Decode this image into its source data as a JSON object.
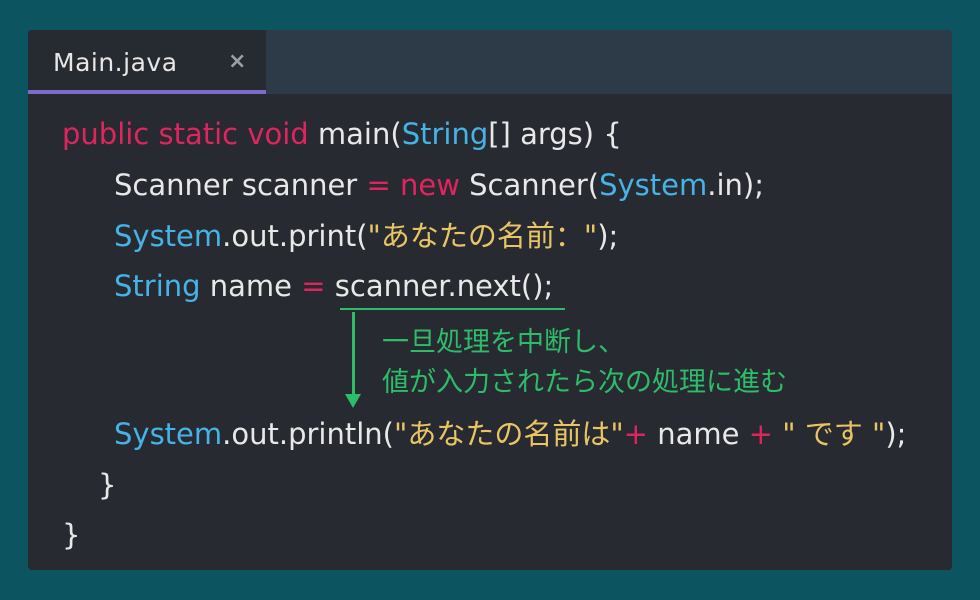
{
  "tab": {
    "label": "Main.java",
    "close": "×"
  },
  "code": {
    "l1": {
      "kw": "public static void",
      "t1": " main(",
      "cls": "String",
      "t2": "[] args) {"
    },
    "l2": {
      "t1": "Scanner scanner ",
      "op": "=",
      "sp": " ",
      "kw": "new",
      "t2": " Scanner(",
      "cls": "System",
      "t3": ".in);"
    },
    "l3": {
      "cls": "System",
      "t1": ".out.print(",
      "str": "\"あなたの名前：\"",
      "t2": ");"
    },
    "l4": {
      "cls": "String",
      "t1": " name ",
      "op": "=",
      "t2": " scanner.next();"
    },
    "l5": {
      "cls": "System",
      "t1": ".out.println(",
      "str1": "\"あなたの名前は\"",
      "op1": "+",
      "t2": " name ",
      "op2": "+",
      "sp": " ",
      "str2": "\" です \"",
      "t3": ");"
    },
    "l6": "}",
    "l7": "}"
  },
  "annotation": {
    "line1": "一旦処理を中断し、",
    "line2": "値が入力されたら次の処理に進む"
  },
  "colors": {
    "background": "#0c5560",
    "editor": "#272a30",
    "keyword": "#e0245e",
    "class": "#46b3e6",
    "string": "#e8c465",
    "annotation": "#2ebc6a",
    "tab_indicator": "#7b6cc7"
  }
}
